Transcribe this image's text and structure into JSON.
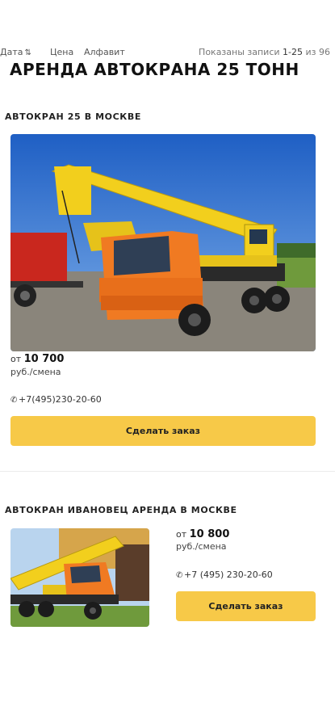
{
  "sort": {
    "date_label": "Дата",
    "sort_icon": "sort-order-icon",
    "price_label": "Цена",
    "alphabet_label": "Алфавит",
    "records_prefix": "Показаны записи",
    "records_range": "1-25",
    "records_of": "из 96"
  },
  "page": {
    "title": "АРЕНДА АВТОКРАНА 25 ТОНН"
  },
  "cards": [
    {
      "title": "АВТОКРАН 25 В МОСКВЕ",
      "price_prefix": "от",
      "price": "10 700",
      "unit": "руб./смена",
      "phone": "+7(495)230-20-60",
      "button": "Сделать заказ"
    },
    {
      "title": "АВТОКРАН ИВАНОВЕЦ АРЕНДА В МОСКВЕ",
      "price_prefix": "от",
      "price": "10 800",
      "unit": "руб./смена",
      "phone": "+7 (495) 230-20-60",
      "button": "Сделать заказ"
    }
  ],
  "colors": {
    "accent": "#f7c948",
    "crane_yellow": "#f2cf1d",
    "truck_orange": "#f07a22"
  },
  "icons": {
    "phone": "phone-icon"
  }
}
